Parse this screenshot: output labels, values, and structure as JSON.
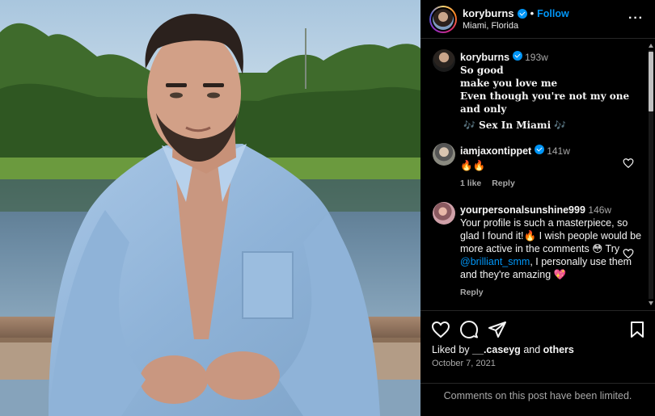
{
  "post": {
    "photo_alt": "",
    "header": {
      "username": "koryburns",
      "separator": "•",
      "follow_label": "Follow",
      "location": "Miami, Florida",
      "more_label": "···"
    },
    "caption": {
      "username": "koryburns",
      "time": "193w",
      "lines": [
        "So good",
        "make you love me",
        "Even though you're not my one and only",
        "🎶 Sex In Miami 🎶"
      ]
    },
    "comments": [
      {
        "username": "iamjaxontippet",
        "time": "141w",
        "text": "🔥🔥",
        "likes_label": "1 like",
        "reply_label": "Reply"
      },
      {
        "username": "yourpersonalsunshine999",
        "time": "146w",
        "text_before": "Your profile is such a masterpiece, so glad I found it!🔥 I wish people would be more active in the comments 😳 Try ",
        "mention": "@brilliant_smm",
        "text_after": ", I personally use them and they're amazing 💖",
        "reply_label": "Reply"
      }
    ],
    "actions": {
      "liked_by_prefix": "Liked by",
      "liked_by_user": "__.caseyg",
      "liked_by_and": "and",
      "liked_by_others": "others",
      "date": "October 7, 2021",
      "comments_limited": "Comments on this post have been limited."
    },
    "colors": {
      "accent": "#0095f6",
      "background": "#000000",
      "muted_text": "#a8a8a8"
    }
  }
}
